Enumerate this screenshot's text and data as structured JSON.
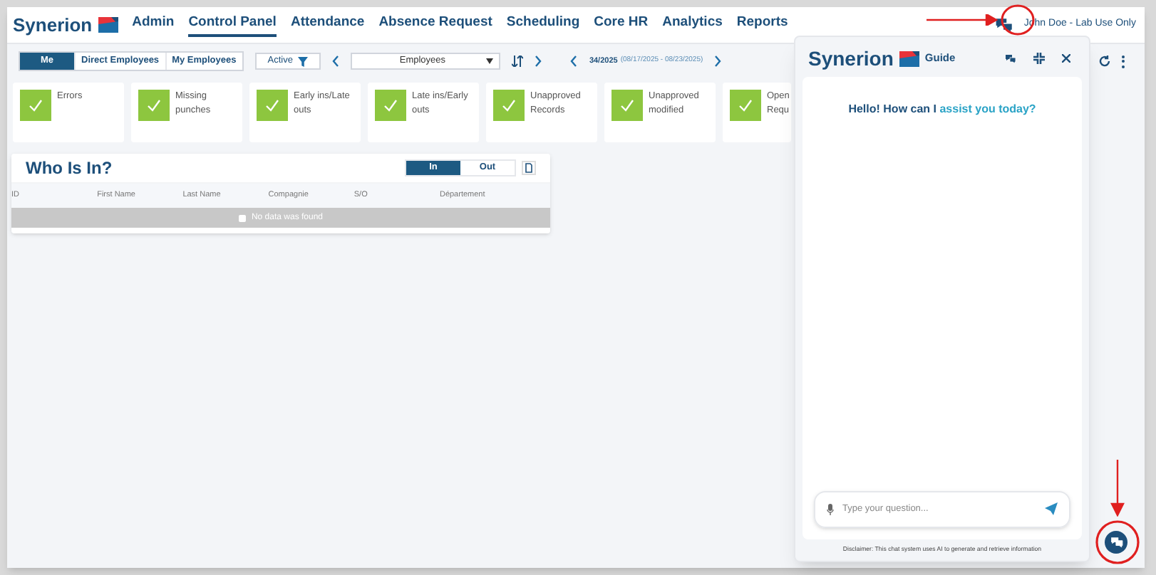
{
  "brand": "Synerion",
  "nav": [
    {
      "label": "Admin",
      "selected": false
    },
    {
      "label": "Control Panel",
      "selected": true
    },
    {
      "label": "Attendance",
      "selected": false
    },
    {
      "label": "Absence Request",
      "selected": false
    },
    {
      "label": "Scheduling",
      "selected": false
    },
    {
      "label": "Core HR",
      "selected": false
    },
    {
      "label": "Analytics",
      "selected": false
    },
    {
      "label": "Reports",
      "selected": false
    }
  ],
  "user": "John Doe - Lab Use Only",
  "scope_tabs": [
    {
      "label": "Me",
      "selected": true
    },
    {
      "label": "Direct Employees",
      "selected": false
    },
    {
      "label": "My Employees",
      "selected": false
    }
  ],
  "status_filter": "Active",
  "group_select": "Employees",
  "week": {
    "number": "34/2025",
    "range": "(08/17/2025 - 08/23/2025)"
  },
  "cards": [
    {
      "label": "Errors"
    },
    {
      "label": "Missing punches"
    },
    {
      "label": "Early ins/Late outs"
    },
    {
      "label": "Late ins/Early outs"
    },
    {
      "label": "Unapproved Records"
    },
    {
      "label": "Unapproved modified"
    },
    {
      "label": "Open Requ"
    }
  ],
  "who_is_in": {
    "title": "Who Is In?",
    "toggle": [
      {
        "label": "In",
        "selected": true
      },
      {
        "label": "Out",
        "selected": false
      }
    ],
    "columns": [
      "ID",
      "First Name",
      "Last Name",
      "Compagnie",
      "S/O",
      "Département"
    ],
    "empty": "No data was found"
  },
  "chat": {
    "brand": "Synerion",
    "title": "Guide",
    "greeting": [
      {
        "text": "Hello! How can I",
        "highlight": false
      },
      {
        "text": "assist you today?",
        "highlight": true
      }
    ],
    "input": {
      "placeholder": "Type your question..."
    },
    "disclaimer": "Disclaimer: This chat system uses AI to generate and retrieve information"
  }
}
